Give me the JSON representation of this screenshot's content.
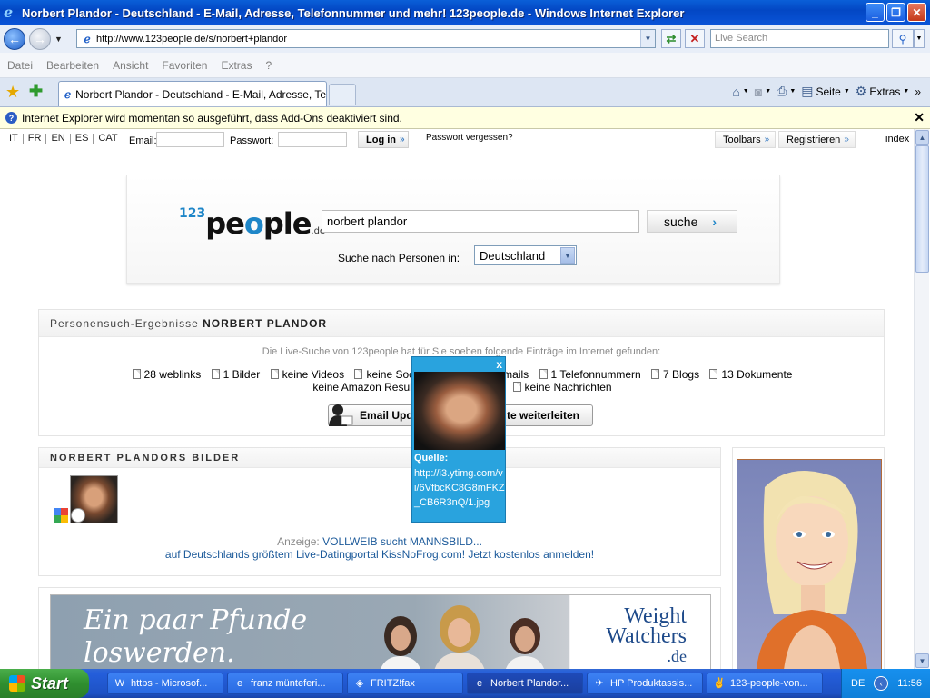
{
  "window": {
    "title": "Norbert Plandor - Deutschland - E-Mail, Adresse, Telefonnummer und mehr! 123people.de - Windows Internet Explorer",
    "min_glyph": "_",
    "max_glyph": "❐",
    "close_glyph": "✕"
  },
  "address_bar": {
    "url": "http://www.123people.de/s/norbert+plandor",
    "live_search_placeholder": "Live Search"
  },
  "menu": [
    "Datei",
    "Bearbeiten",
    "Ansicht",
    "Favoriten",
    "Extras",
    "?"
  ],
  "tab": {
    "title": "Norbert Plandor - Deutschland - E-Mail, Adresse, Tele..."
  },
  "command_bar": {
    "page": "Seite",
    "tools": "Extras"
  },
  "infobar": {
    "text": "Internet Explorer wird momentan so ausgeführt, dass Add-Ons deaktiviert sind."
  },
  "topstrip": {
    "languages": [
      "IT",
      "FR",
      "EN",
      "ES",
      "CAT"
    ],
    "email_label": "Email:",
    "password_label": "Passwort:",
    "login": "Log in",
    "forgot": "Passwort vergessen?",
    "toolbars": "Toolbars",
    "register": "Registrieren",
    "index": "index"
  },
  "search": {
    "logo_number": "123",
    "logo_word_a": "pe",
    "logo_word_o": "o",
    "logo_word_b": "ple",
    "logo_tld": ".de",
    "query": "norbert plandor",
    "button": "suche",
    "region_label": "Suche nach Personen in:",
    "region": "Deutschland"
  },
  "results": {
    "heading_prefix": "Personensuch-Ergebnisse",
    "heading_name": "NORBERT PLANDOR",
    "live_text": "Die Live-Suche von 123people hat für Sie soeben folgende Einträge im Internet gefunden:",
    "counts": [
      "28 weblinks",
      "1 Bilder",
      "keine Videos",
      "keine Social Netw",
      "e Emails",
      "1 Telefonnummern",
      "7 Blogs",
      "13 Dokumente"
    ],
    "counts_row2_a": "keine Amazon Result",
    "counts_row2_b": "keine Nachrichten",
    "email_btn_left": "Email Upda",
    "email_btn_right": "te weiterleiten"
  },
  "pictures": {
    "heading": "NORBERT PLANDORS BILDER",
    "ad_label": "Anzeige:",
    "ad_link": "VOLLWEIB sucht MANNSBILD...",
    "ad_text": "auf Deutschlands größtem Live-Datingportal KissNoFrog.com! Jetzt kostenlos anmelden!"
  },
  "banner": {
    "line1": "Ein paar Pfunde",
    "line2": "loswerden.",
    "brand1": "Weight",
    "brand2": "Watchers",
    "brand_tld": ".de"
  },
  "popup": {
    "close": "x",
    "source_label": "Quelle:",
    "source_url": "http://i3.ytimg.com/vi/6VfbcKC8G8mFKZ_CB6R3nQ/1.jpg"
  },
  "taskbar": {
    "start": "Start",
    "tasks": [
      {
        "label": "https - Microsof...",
        "icon": "W"
      },
      {
        "label": "franz münteferi...",
        "icon": "e"
      },
      {
        "label": "FRITZ!fax",
        "icon": "◈"
      },
      {
        "label": "Norbert Plandor...",
        "icon": "e"
      },
      {
        "label": "HP Produktassis...",
        "icon": "✈"
      },
      {
        "label": "123-people-von...",
        "icon": "✌"
      }
    ],
    "lang": "DE",
    "clock": "11:56"
  }
}
